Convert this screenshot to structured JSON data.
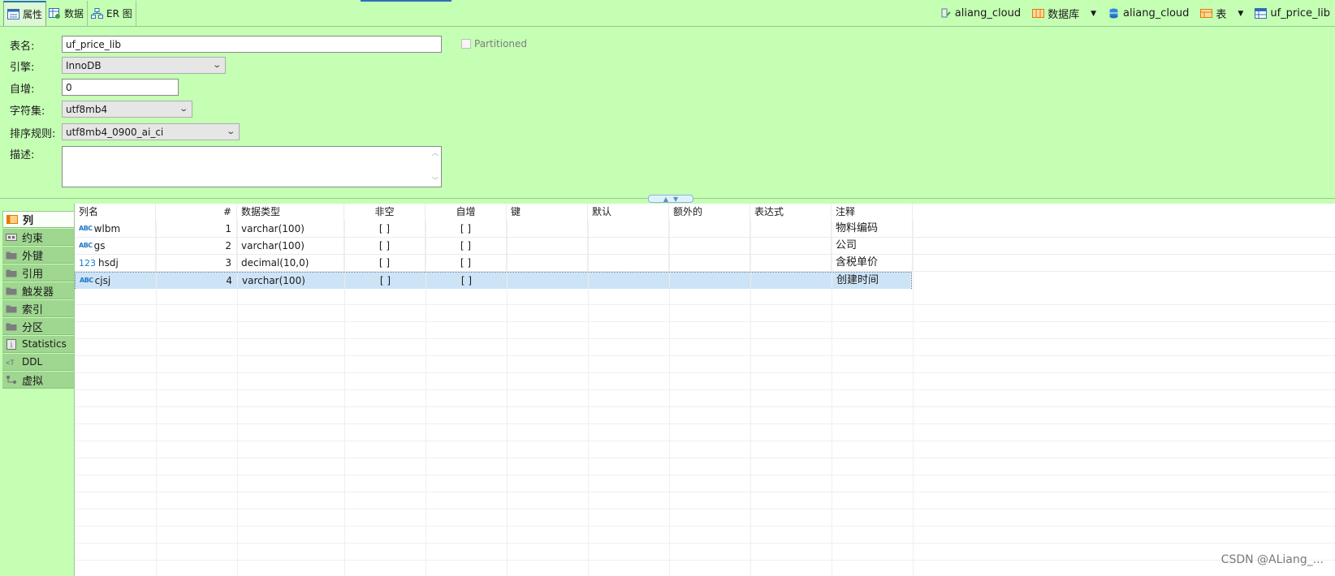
{
  "top_tabs": [
    {
      "label": "属性",
      "icon": "properties-icon",
      "active": true
    },
    {
      "label": "数据",
      "icon": "data-grid-icon",
      "active": false
    },
    {
      "label": "ER 图",
      "icon": "er-diagram-icon",
      "active": false
    }
  ],
  "breadcrumb": {
    "connection": "aliang_cloud",
    "db_type": "数据库",
    "database": "aliang_cloud",
    "object_type": "表",
    "table": "uf_price_lib"
  },
  "form": {
    "table_name_label": "表名:",
    "table_name": "uf_price_lib",
    "partitioned_label": "Partitioned",
    "engine_label": "引擎:",
    "engine": "InnoDB",
    "auto_inc_label": "自增:",
    "auto_inc": "0",
    "charset_label": "字符集:",
    "charset": "utf8mb4",
    "collation_label": "排序规则:",
    "collation": "utf8mb4_0900_ai_ci",
    "description_label": "描述:"
  },
  "side_tabs": [
    {
      "label": "列",
      "icon": "columns-icon",
      "active": true
    },
    {
      "label": "约束",
      "icon": "constraint-icon"
    },
    {
      "label": "外键",
      "icon": "folder-icon"
    },
    {
      "label": "引用",
      "icon": "folder-icon"
    },
    {
      "label": "触发器",
      "icon": "folder-icon"
    },
    {
      "label": "索引",
      "icon": "folder-icon"
    },
    {
      "label": "分区",
      "icon": "folder-icon"
    },
    {
      "label": "Statistics",
      "icon": "info-icon"
    },
    {
      "label": "DDL",
      "icon": "ddl-icon"
    },
    {
      "label": "虚拟",
      "icon": "virtual-icon"
    }
  ],
  "grid": {
    "headers": [
      "列名",
      "#",
      "数据类型",
      "非空",
      "自增",
      "键",
      "默认",
      "额外的",
      "表达式",
      "注释"
    ],
    "rows": [
      {
        "type_tag": "ABC",
        "name": "wlbm",
        "num": "1",
        "datatype": "varchar(100)",
        "notnull": "[ ]",
        "autoinc": "[ ]",
        "key": "",
        "default": "",
        "extra": "",
        "expr": "",
        "comment": "物料编码"
      },
      {
        "type_tag": "ABC",
        "name": "gs",
        "num": "2",
        "datatype": "varchar(100)",
        "notnull": "[ ]",
        "autoinc": "[ ]",
        "key": "",
        "default": "",
        "extra": "",
        "expr": "",
        "comment": "公司"
      },
      {
        "type_tag": "123",
        "name": "hsdj",
        "num": "3",
        "datatype": "decimal(10,0)",
        "notnull": "[ ]",
        "autoinc": "[ ]",
        "key": "",
        "default": "",
        "extra": "",
        "expr": "",
        "comment": "含税单价"
      },
      {
        "type_tag": "ABC",
        "name": "cjsj",
        "num": "4",
        "datatype": "varchar(100)",
        "notnull": "[ ]",
        "autoinc": "[ ]",
        "key": "",
        "default": "",
        "extra": "",
        "expr": "",
        "comment": "创建时间"
      }
    ]
  },
  "watermark": "CSDN @ALiang_...",
  "colors": {
    "background": "#c4ffb4",
    "accent": "#2f6fc2",
    "selection": "#cde4f7"
  }
}
